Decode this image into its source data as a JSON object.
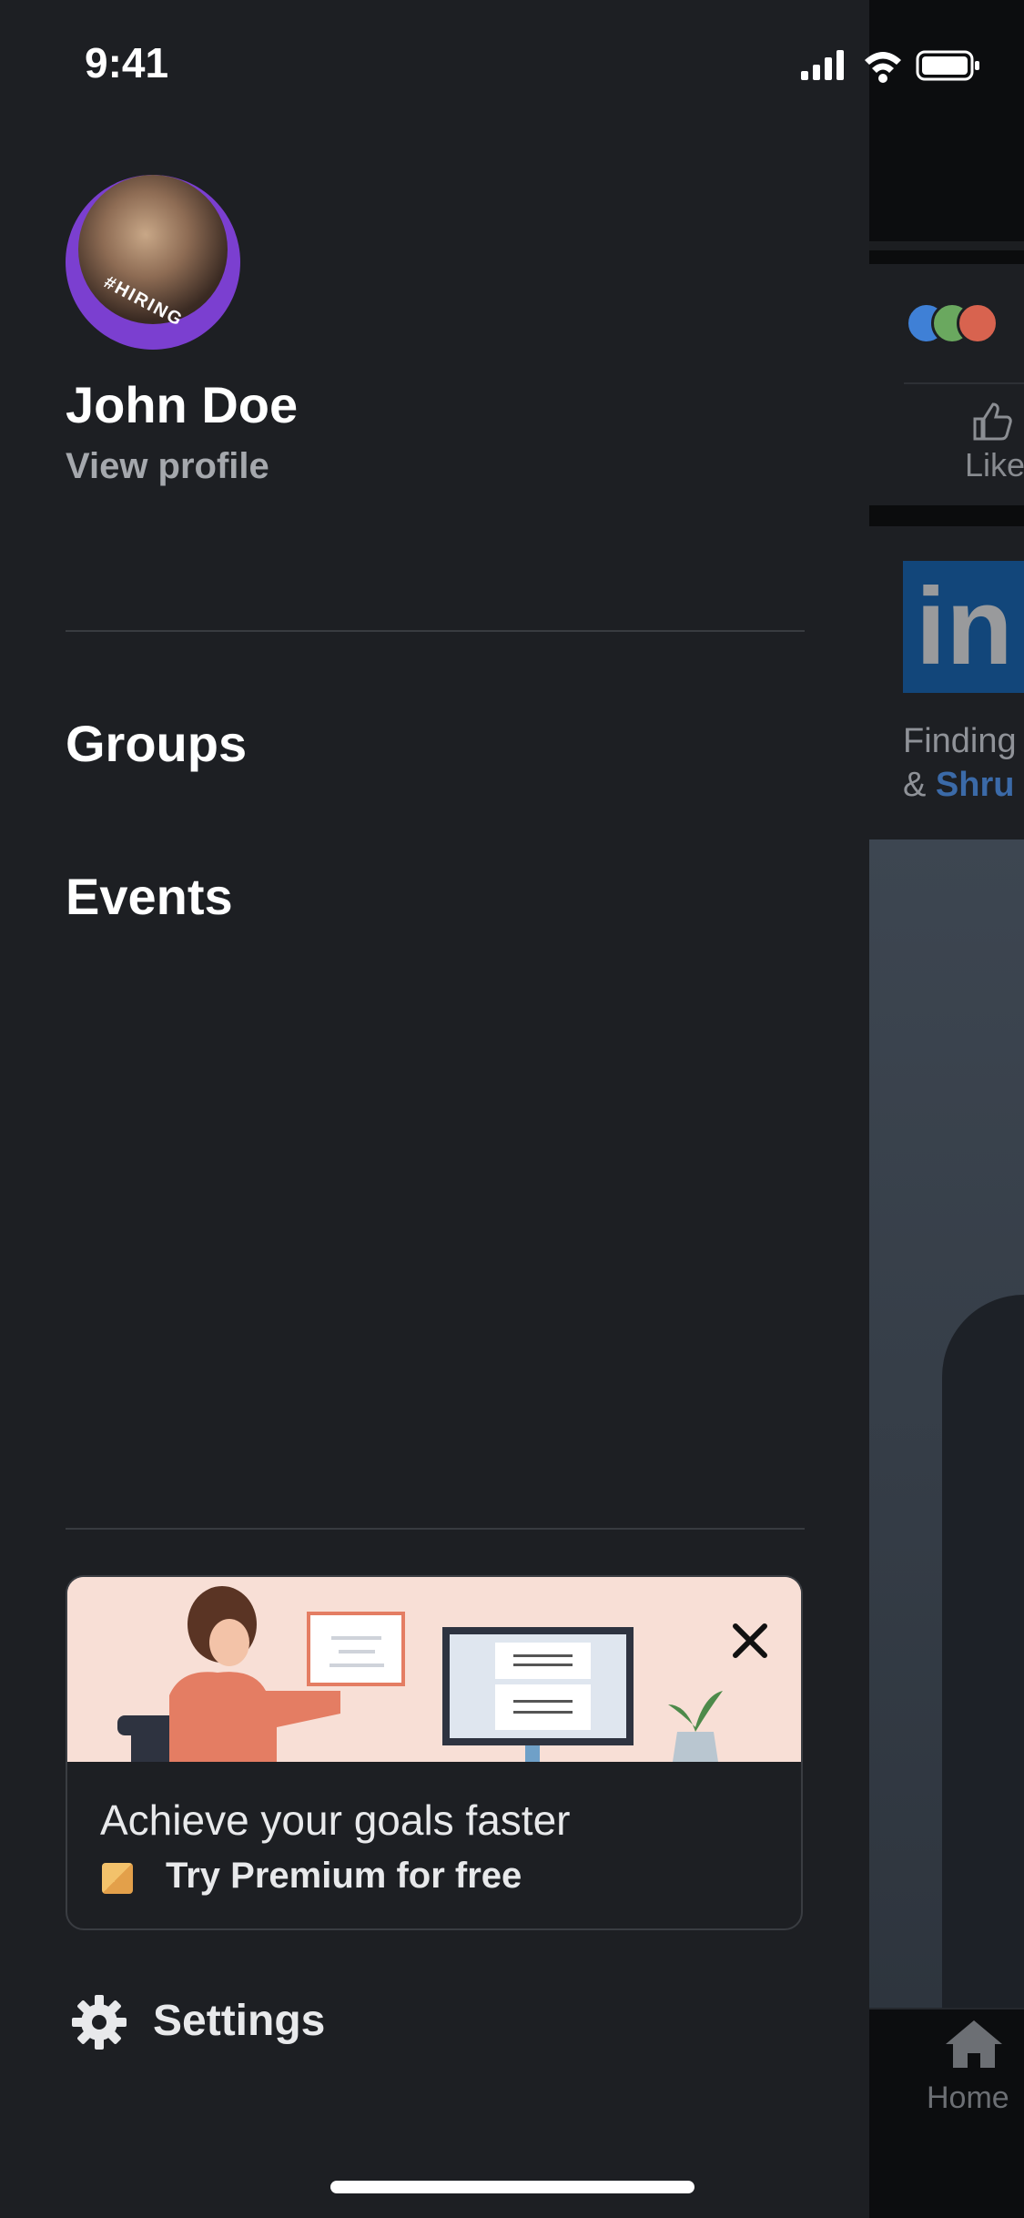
{
  "status_bar": {
    "time": "9:41"
  },
  "drawer": {
    "profile": {
      "name": "John Doe",
      "view_profile": "View profile",
      "avatar_badge": "#HIRING"
    },
    "menu": [
      {
        "label": "Groups"
      },
      {
        "label": "Events"
      }
    ],
    "premium": {
      "title": "Achieve your goals faster",
      "cta": "Try Premium for free"
    },
    "settings": {
      "label": "Settings"
    }
  },
  "background_feed": {
    "like_label": "Like",
    "post_text_line1": "Finding",
    "post_text_line2_prefix": "& ",
    "post_text_line2_link": "Shru",
    "home_label": "Home",
    "logo_text": "in"
  },
  "colors": {
    "drawer_bg": "#1d1f23",
    "linkedin_blue": "#0a66c2",
    "premium_gold": "#f3c26b",
    "avatar_ring": "#7b3fd0"
  }
}
